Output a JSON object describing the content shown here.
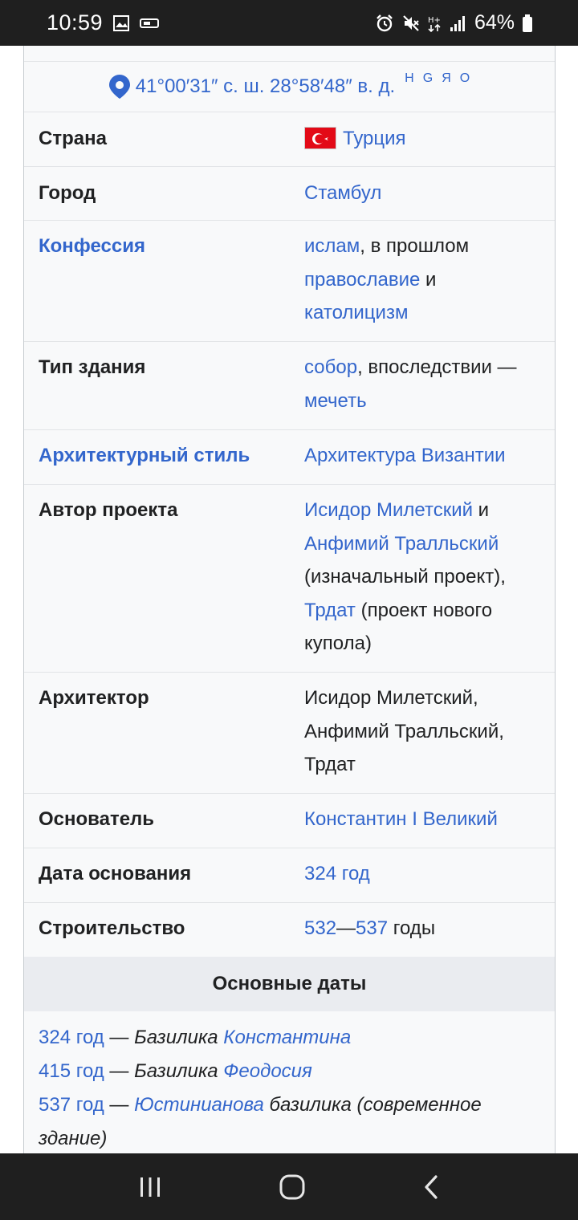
{
  "status_bar": {
    "time": "10:59",
    "battery_percent": "64%",
    "network": "H+"
  },
  "coordinates": {
    "text": "41°00′31″ с. ш. 28°58′48″ в. д.",
    "links": [
      "H",
      "G",
      "Я",
      "O"
    ]
  },
  "rows": {
    "country": {
      "label": "Страна",
      "value": "Турция"
    },
    "city": {
      "label": "Город",
      "value": "Стамбул"
    },
    "confession": {
      "label": "Конфессия",
      "v1": "ислам",
      "v2": ", в прошлом ",
      "v3": "православие",
      "v4": " и ",
      "v5": "католицизм"
    },
    "building_type": {
      "label": "Тип здания",
      "v1": "собор",
      "v2": ", впоследствии — ",
      "v3": "мечеть"
    },
    "style": {
      "label": "Архитектурный стиль",
      "value": "Архитектура Византии"
    },
    "author": {
      "label": "Автор проекта",
      "v1": "Исидор Милетский",
      "v2": " и ",
      "v3": "Анфимий Тралльский",
      "v4": " (изначальный проект), ",
      "v5": "Трдат",
      "v6": " (проект нового купола)"
    },
    "architect": {
      "label": "Архитектор",
      "value": "Исидор Милетский, Анфимий Тралльский, Трдат"
    },
    "founder": {
      "label": "Основатель",
      "value": "Константин I Великий"
    },
    "founded": {
      "label": "Дата основания",
      "value": "324 год"
    },
    "construction": {
      "label": "Строительство",
      "v1": "532",
      "v2": "—",
      "v3": "537",
      "v4": " годы"
    }
  },
  "key_dates": {
    "heading": "Основные даты",
    "items": [
      {
        "year": "324 год",
        "dash": " — ",
        "t1": "Базилика ",
        "link": "Константина",
        "t2": ""
      },
      {
        "year": "415 год",
        "dash": " — ",
        "t1": "Базилика ",
        "link": "Феодосия",
        "t2": ""
      },
      {
        "year": "537 год",
        "dash": " — ",
        "t1": "",
        "link": "Юстинианова",
        "t2": " базилика (современное здание)"
      }
    ]
  },
  "colors": {
    "link": "#3366cc",
    "infobox_bg": "#f8f9fa",
    "section_bg": "#eaecf0",
    "system_bar": "#1f1f1f"
  }
}
